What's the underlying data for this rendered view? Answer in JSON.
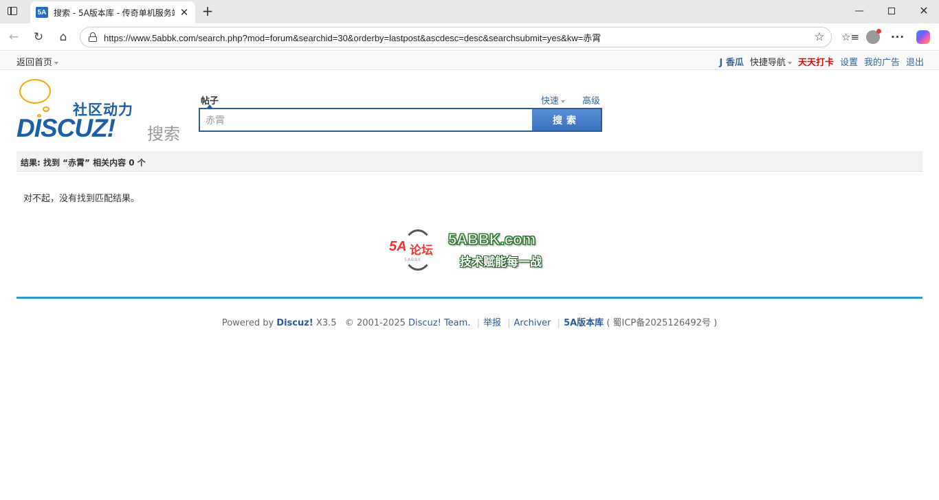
{
  "browser": {
    "tab_title": "搜索 - 5A版本库 - 传奇单机服务端",
    "favicon_text": "5A",
    "url": "https://www.5abbk.com/search.php?mod=forum&searchid=30&orderby=lastpost&ascdesc=desc&searchsubmit=yes&kw=赤霄"
  },
  "topnav": {
    "home": "返回首页",
    "user": "J 香瓜",
    "quick_nav": "快捷导航",
    "checkin": "天天打卡",
    "settings": "设置",
    "my_ads": "我的广告",
    "logout": "退出"
  },
  "logo": {
    "cn_text": "社区动力",
    "en_text": "DISCUZ!",
    "sub_text": "搜索"
  },
  "search": {
    "type_label": "帖子",
    "quick_label": "快速",
    "advanced_label": "高级",
    "query": "赤霄",
    "button_label": "搜索"
  },
  "results": {
    "summary": "结果: 找到 “赤霄” 相关内容 0 个",
    "empty_message": "对不起，没有找到匹配结果。"
  },
  "promo": {
    "emblem_text": "5A",
    "emblem_cn": "论坛",
    "emblem_small": "5ABBK",
    "site": "5ABBK.com",
    "slogan": "技术赋能每一战"
  },
  "footer": {
    "powered_by": "Powered by ",
    "brand": "Discuz!",
    "version": " X3.5",
    "copyright": "© 2001-2025 ",
    "team": "Discuz! Team.",
    "report": "举报",
    "archiver": "Archiver",
    "site_name": "5A版本库",
    "icp": "( 蜀ICP备2025126492号 )"
  }
}
